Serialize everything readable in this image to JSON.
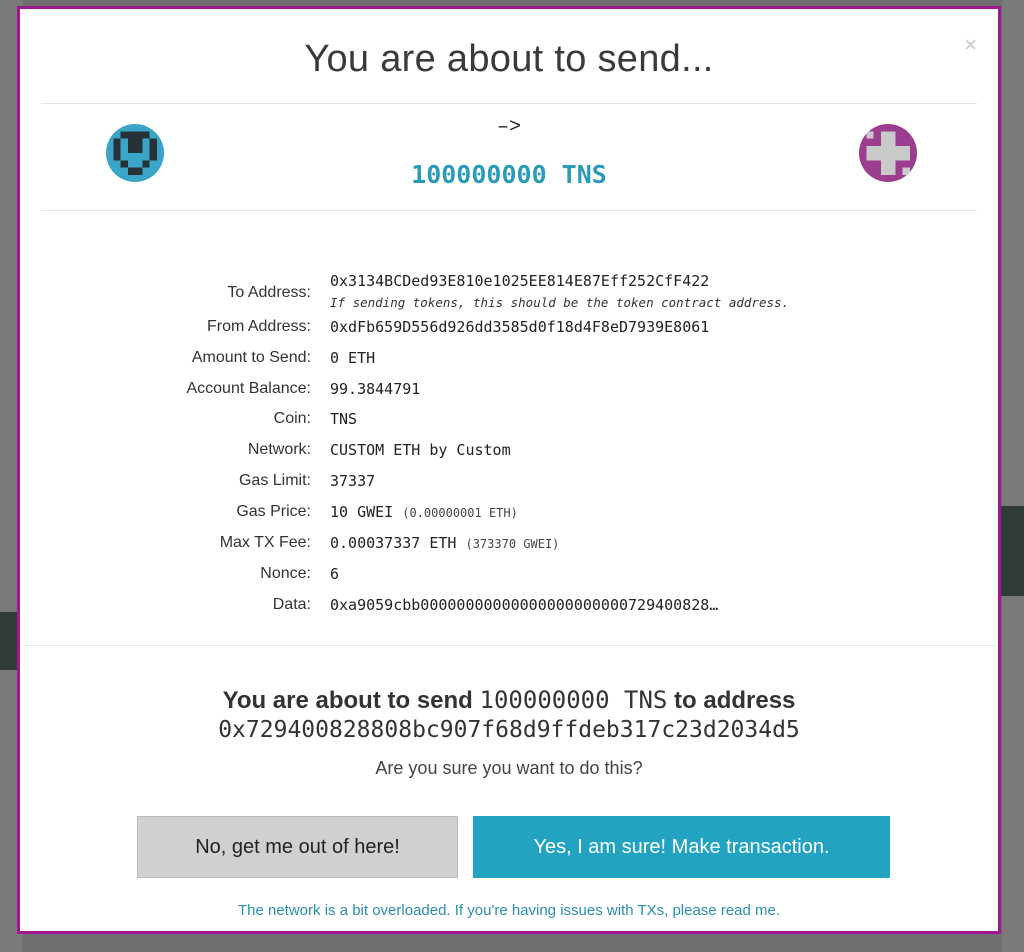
{
  "modal": {
    "title": "You are about to send...",
    "close_symbol": "×",
    "arrow": "–>",
    "send_amount": "100000000 TNS",
    "from_identicon": "identicon-blue",
    "to_identicon": "identicon-magenta"
  },
  "details": {
    "to_address": {
      "label": "To Address:",
      "value": "0x3134BCDed93E810e1025EE814E87Eff252CfF422",
      "note": "If sending tokens, this should be the token contract address."
    },
    "from_address": {
      "label": "From Address:",
      "value": "0xdFb659D556d926dd3585d0f18d4F8eD7939E8061"
    },
    "amount": {
      "label": "Amount to Send:",
      "value": "0 ETH"
    },
    "balance": {
      "label": "Account Balance:",
      "value": "99.3844791"
    },
    "coin": {
      "label": "Coin:",
      "value": "TNS"
    },
    "network": {
      "label": "Network:",
      "value": "CUSTOM ETH by Custom"
    },
    "gas_limit": {
      "label": "Gas Limit:",
      "value": "37337"
    },
    "gas_price": {
      "label": "Gas Price:",
      "value": "10 GWEI",
      "sub": "(0.00000001 ETH)"
    },
    "max_fee": {
      "label": "Max TX Fee:",
      "value": "0.00037337 ETH",
      "sub": "(373370 GWEI)"
    },
    "nonce": {
      "label": "Nonce:",
      "value": "6"
    },
    "data": {
      "label": "Data:",
      "value": "0xa9059cbb00000000000000000000000729400828…"
    }
  },
  "confirm": {
    "prefix": "You are about to send",
    "amount": "100000000 TNS",
    "suffix": "to address",
    "address": "0x729400828808bc907f68d9ffdeb317c23d2034d5",
    "question": "Are you sure you want to do this?"
  },
  "buttons": {
    "no": "No, get me out of here!",
    "yes": "Yes, I am sure! Make transaction."
  },
  "footer": {
    "link": "The network is a bit overloaded. If you're having issues with TXs, please read me."
  },
  "colors": {
    "frame": "#a0188f",
    "accent": "#22a3c2",
    "amount_text": "#2a9bb8"
  }
}
